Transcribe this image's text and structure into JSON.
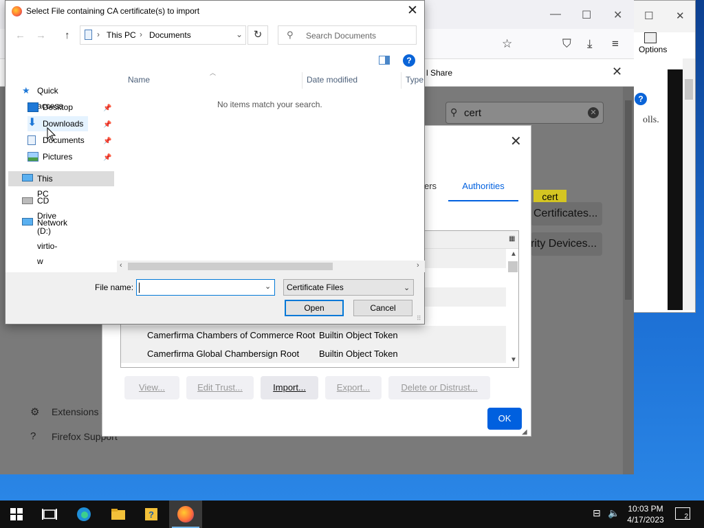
{
  "file_dialog": {
    "title": "Select File containing CA certificate(s) to import",
    "breadcrumb": [
      "This PC",
      "Documents"
    ],
    "search_placeholder": "Search Documents",
    "nav": {
      "quick_access": "Quick access",
      "desktop": "Desktop",
      "downloads": "Downloads",
      "documents": "Documents",
      "pictures": "Pictures",
      "this_pc": "This PC",
      "cd_drive": "CD Drive (D:) virtio-w",
      "network": "Network"
    },
    "columns": [
      "Name",
      "Date modified",
      "Type"
    ],
    "empty_message": "No items match your search.",
    "file_name_label": "File name:",
    "file_name_value": "",
    "file_type": "Certificate Files",
    "open_label": "Open",
    "cancel_label": "Cancel"
  },
  "firefox": {
    "share_label": "l Share",
    "search_value": "cert",
    "highlight_text": "cert",
    "certificates_button": "Certificates...",
    "security_devices_button": "rity Devices...",
    "extensions_link": "Extensions &",
    "support_link": "Firefox Support"
  },
  "cert_manager": {
    "tab_partial": "ers",
    "tab_authorities": "Authorities",
    "rows": [
      {
        "name": "Camerfirma Chambers of Commerce Root",
        "token": "Builtin Object Token"
      },
      {
        "name": "Camerfirma Global Chambersign Root",
        "token": "Builtin Object Token"
      }
    ],
    "buttons": {
      "view": "View...",
      "edit_trust": "Edit Trust...",
      "import": "Import...",
      "export": "Export...",
      "delete": "Delete or Distrust..."
    },
    "ok_label": "OK"
  },
  "bg_window": {
    "options_label": "Options",
    "text": "olls."
  },
  "taskbar": {
    "time": "10:03 PM",
    "date": "4/17/2023",
    "notification_count": "2"
  }
}
